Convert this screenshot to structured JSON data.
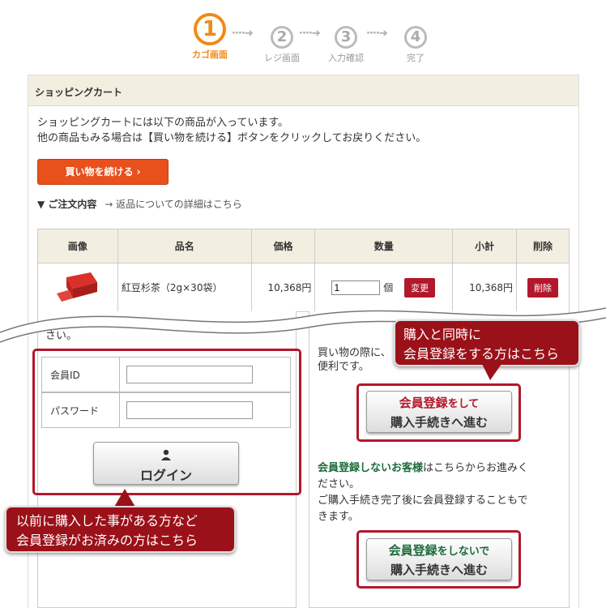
{
  "steps": [
    {
      "num": "1",
      "label": "カゴ画面"
    },
    {
      "num": "2",
      "label": "レジ画面"
    },
    {
      "num": "3",
      "label": "入力確認"
    },
    {
      "num": "4",
      "label": "完了"
    }
  ],
  "arrow": "····➔",
  "panel": {
    "title": "ショッピングカート",
    "intro1": "ショッピングカートには以下の商品が入っています。",
    "intro2": "他の商品もみる場合は【買い物を続ける】ボタンをクリックしてお戻りください。",
    "continue_btn": "買い物を続ける ›",
    "order_label": "▼ ご注文内容",
    "return_link": "→ 返品についての詳細はこちら"
  },
  "cart": {
    "headers": [
      "画像",
      "品名",
      "価格",
      "数量",
      "小計",
      "削除"
    ],
    "row": {
      "name": "紅豆杉茶（2g×30袋）",
      "price": "10,368円",
      "qty": "1",
      "unit": "個",
      "change": "変更",
      "subtotal": "10,368円",
      "delete": "削除"
    }
  },
  "login": {
    "partial": "さい。",
    "id_label": "会員ID",
    "pw_label": "パスワード",
    "login_btn": "ログイン"
  },
  "register": {
    "partial1": "買い物の際に、",
    "partial2": "便利です。",
    "btn_line1a": "会員登録",
    "btn_line1b": "をして",
    "btn_line2": "購入手続きへ進む",
    "guest_bold": "会員登録しないお客様",
    "guest_text1": "はこちらからお進みく",
    "guest_text2": "ださい。",
    "guest_text3": "ご購入手続き完了後に会員登録することもで",
    "guest_text4": "きます。",
    "guest_btn_line1a": "会員登録",
    "guest_btn_line1b": "をしないで",
    "guest_btn_line2": "購入手続きへ進む"
  },
  "callouts": {
    "register_line1": "購入と同時に",
    "register_line2": "会員登録をする方はこちら",
    "login_line1": "以前に購入した事がある方など",
    "login_line2": "会員登録がお済みの方はこちら"
  },
  "colors": {
    "accent": "#f08a17",
    "red": "#b2182b",
    "orange": "#e8501c",
    "green": "#1c6b3a"
  }
}
